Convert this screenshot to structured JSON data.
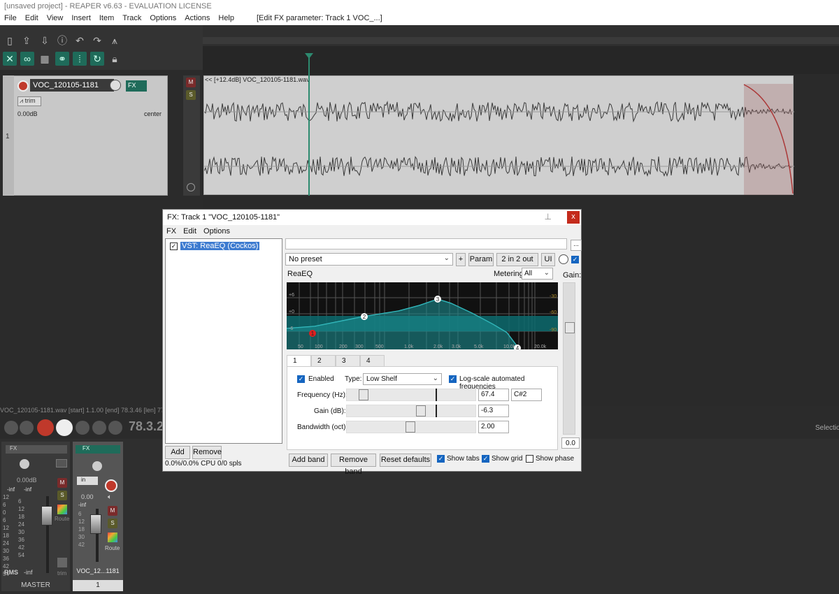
{
  "window_title": "[unsaved project] - REAPER v6.63 - EVALUATION LICENSE",
  "menu": [
    "File",
    "Edit",
    "View",
    "Insert",
    "Item",
    "Track",
    "Options",
    "Actions",
    "Help"
  ],
  "menu_fx_param": "[Edit FX parameter: Track 1 VOC_...]",
  "track": {
    "number": "1",
    "name": "VOC_120105-1181",
    "fx_label": "FX",
    "trim_label": "trim",
    "volume": "0.00dB",
    "pan": "center",
    "mute": "M",
    "solo": "S"
  },
  "item_label": "<< [+12.4dB] VOC_120105-1181.wav",
  "status_line": "VOC_120105-1181.wav [start] 1.1.00 [end] 78.3.46 [len] 77",
  "time_display": "78.3.2",
  "right_status": "Selectio",
  "mixer": {
    "master": {
      "fx": "FX",
      "volume": "0.00dB",
      "left_peak": "-inf",
      "right_peak": "-inf",
      "rms": "RMS",
      "rms_val": "-inf",
      "route": "Route",
      "trim": "trim",
      "mute": "M",
      "solo": "S",
      "label": "MASTER",
      "scale_left": [
        "12",
        "6",
        "0",
        "6",
        "12",
        "18",
        "24",
        "30",
        "36",
        "42",
        "54"
      ],
      "scale_right": [
        "6",
        "12",
        "18",
        "24",
        "30",
        "36",
        "42",
        "54"
      ]
    },
    "track1": {
      "fx": "FX",
      "in": "in",
      "volume": "0.00",
      "peak": "-inf",
      "route": "Route",
      "mute": "M",
      "solo": "S",
      "label": "VOC_12...1181",
      "number": "1",
      "scale": [
        "6",
        "12",
        "18",
        "30",
        "42"
      ]
    }
  },
  "fx_window": {
    "title": "FX: Track 1 \"VOC_120105-1181\"",
    "close": "x",
    "menu": [
      "FX",
      "Edit",
      "Options"
    ],
    "plugin_entry": "VST: ReaEQ (Cockos)",
    "add": "Add",
    "remove": "Remove",
    "cpu": "0.0%/0.0% CPU 0/0 spls",
    "dots": "...",
    "preset": "No preset",
    "plus": "+",
    "param": "Param",
    "io": "2 in 2 out",
    "ui": "UI",
    "plugin_name": "ReaEQ",
    "metering_label": "Metering:",
    "metering_value": "All",
    "gain_label": "Gain:",
    "gain_value": "0.0",
    "graph": {
      "y_labels": [
        "+6",
        "+0",
        "-6"
      ],
      "right_labels": [
        "-30",
        "-60",
        "-90"
      ],
      "freq_labels": [
        "50",
        "100",
        "200",
        "300",
        "500",
        "1.0k",
        "2.0k",
        "3.0k",
        "5.0k",
        "10.0k",
        "20.0k"
      ],
      "nodes": [
        "1",
        "2",
        "3",
        "4"
      ]
    },
    "tabs": [
      "1",
      "2",
      "3",
      "4"
    ],
    "enabled_label": "Enabled",
    "type_label": "Type:",
    "type_value": "Low Shelf",
    "log_scale_label": "Log-scale automated frequencies",
    "frequency_label": "Frequency (Hz):",
    "frequency_value": "67.4",
    "note_value": "C#2",
    "gain_db_label": "Gain (dB):",
    "gain_db_value": "-6.3",
    "bandwidth_label": "Bandwidth (oct):",
    "bandwidth_value": "2.00",
    "add_band": "Add band",
    "remove_band": "Remove band",
    "reset_defaults": "Reset defaults",
    "show_tabs": "Show tabs",
    "show_grid": "Show grid",
    "show_phase": "Show phase",
    "show_tabs_checked": true,
    "show_grid_checked": true,
    "show_phase_checked": false
  },
  "colors": {
    "accent_teal": "#1f6b5a",
    "eq_curve": "#39c4c8",
    "record_red": "#c0392b"
  }
}
